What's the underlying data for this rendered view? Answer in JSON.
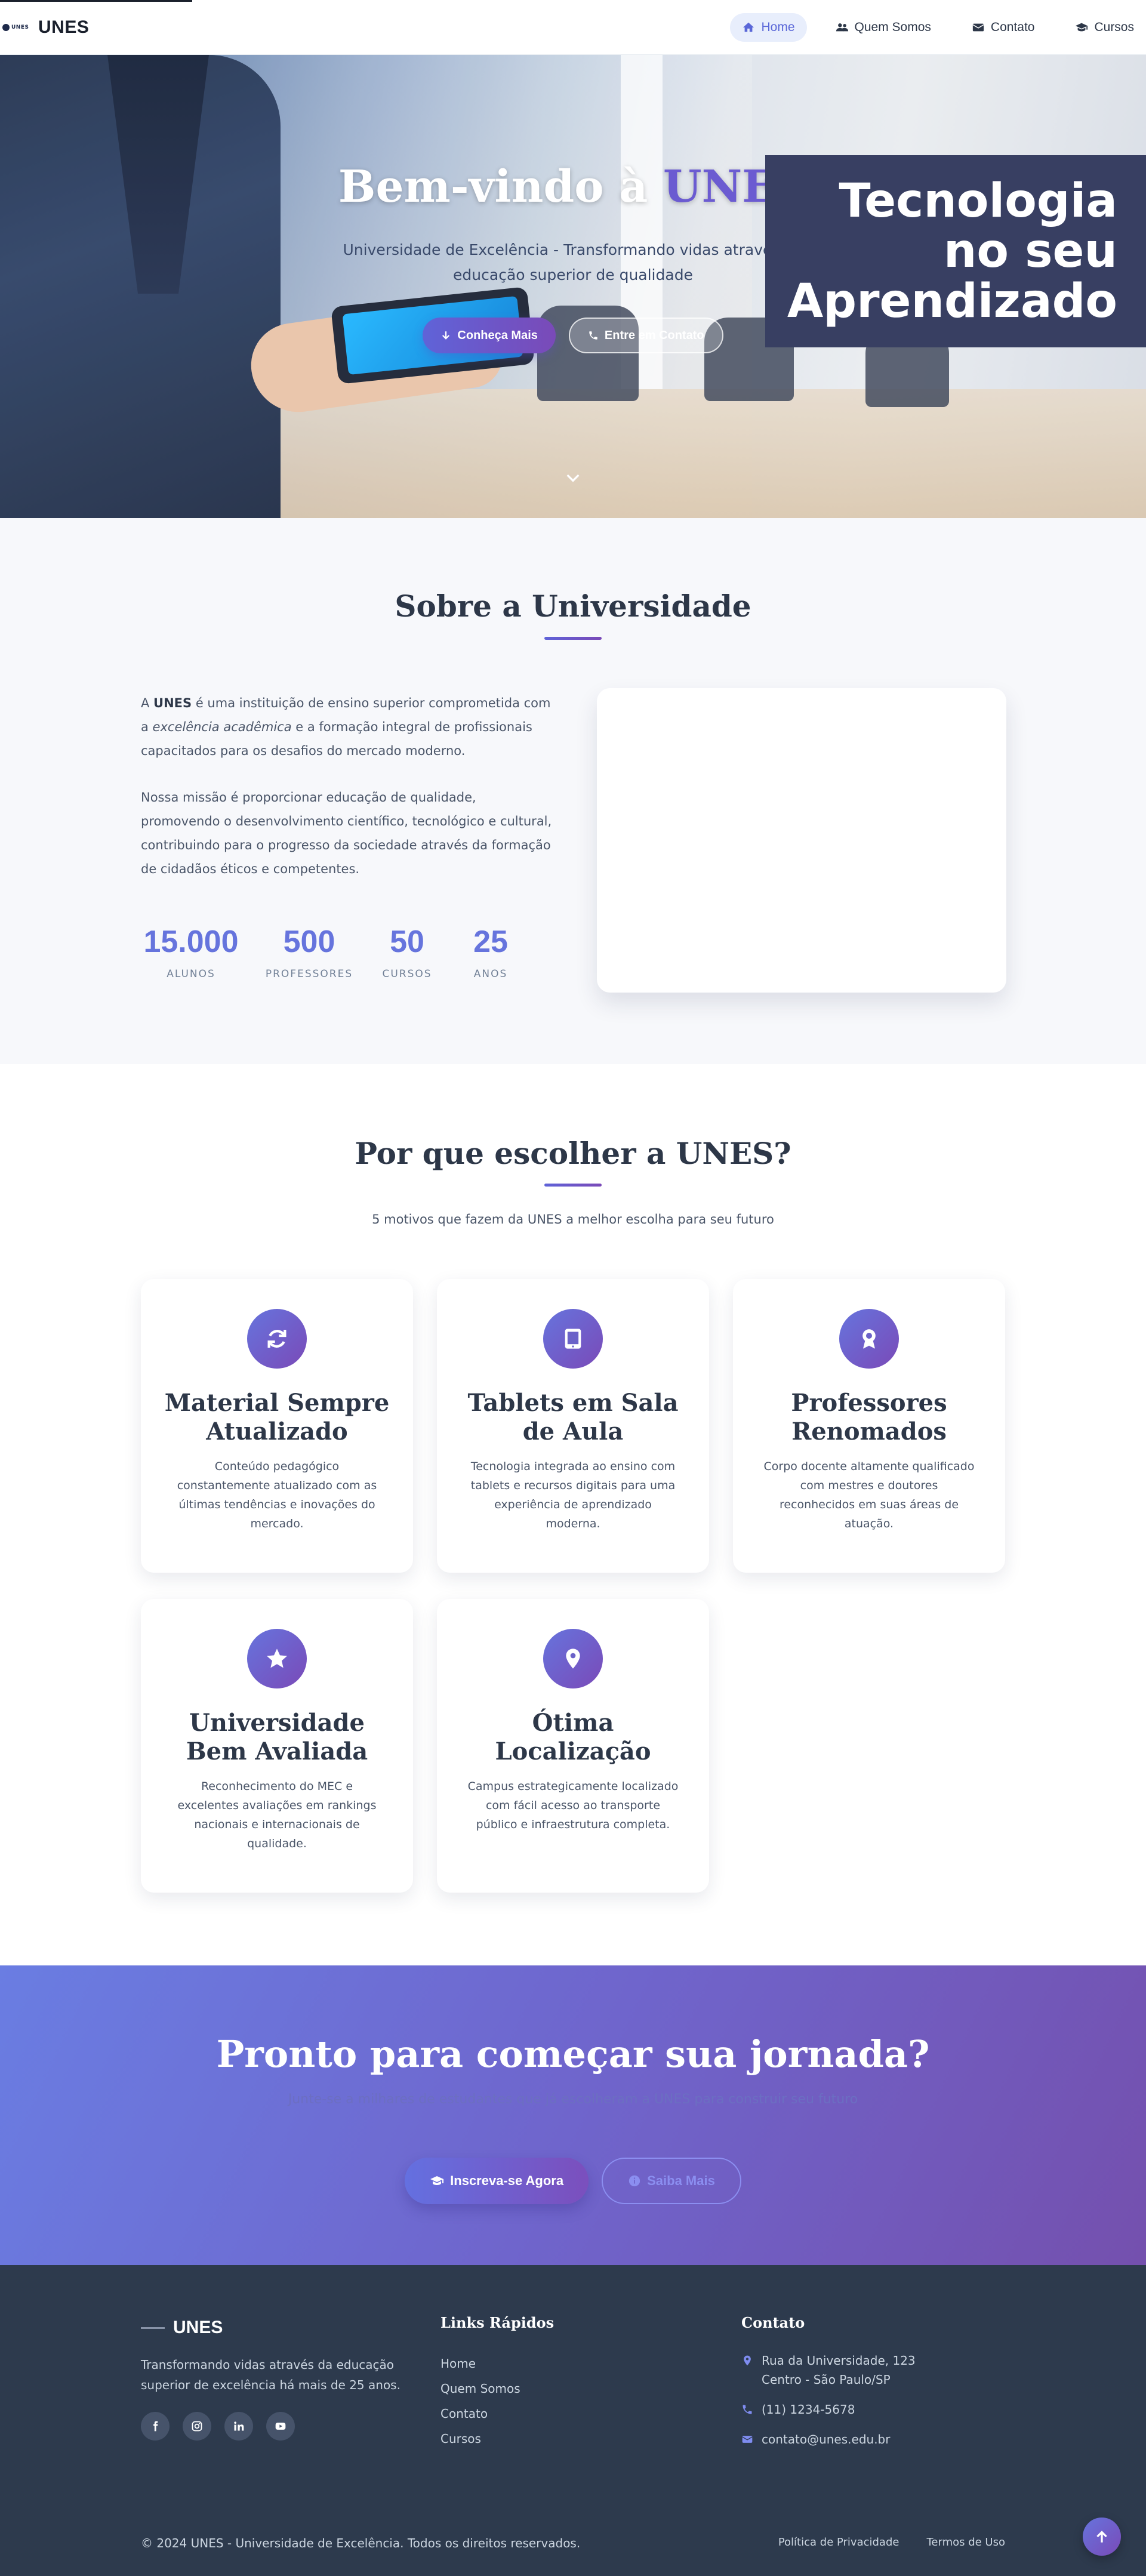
{
  "colors": {
    "primary": "#667eea",
    "secondary": "#764ba2",
    "dark": "#2d3748",
    "footer": "#2d3a4d"
  },
  "nav": {
    "brand_logo_text": "UNES",
    "brand": "UNES",
    "links": [
      {
        "label": "Home",
        "icon": "home-icon",
        "active": true
      },
      {
        "label": "Quem Somos",
        "icon": "users-icon",
        "active": false
      },
      {
        "label": "Contato",
        "icon": "envelope-icon",
        "active": false
      },
      {
        "label": "Cursos",
        "icon": "graduation-cap-icon",
        "active": false
      }
    ]
  },
  "hero": {
    "title_prefix": "Bem-vindo à ",
    "title_accent": "UNES",
    "subtitle": "Universidade de Excelência - Transformando vidas através da educação superior de qualidade",
    "btn_primary": "Conheça Mais",
    "btn_secondary": "Entre em Contato",
    "ad_lines": [
      "Tecnologia",
      "no seu",
      "Aprendizado"
    ]
  },
  "about": {
    "title": "Sobre a Universidade",
    "p1_prefix": "A ",
    "p1_bold": "UNES",
    "p1_mid": " é uma instituição de ensino superior comprometida com a ",
    "p1_italic": "excelência acadêmica",
    "p1_suffix": " e a formação integral de profissionais capacitados para os desafios do mercado moderno.",
    "p2": "Nossa missão é proporcionar educação de qualidade, promovendo o desenvolvimento científico, tecnológico e cultural, contribuindo para o progresso da sociedade através da formação de cidadãos éticos e competentes.",
    "stats": [
      {
        "value": "15.000",
        "label": "ALUNOS"
      },
      {
        "value": "500",
        "label": "PROFESSORES"
      },
      {
        "value": "50",
        "label": "CURSOS"
      },
      {
        "value": "25",
        "label": "ANOS"
      }
    ]
  },
  "why": {
    "title": "Por que escolher a UNES?",
    "subtitle": "5 motivos que fazem da UNES a melhor escolha para seu futuro",
    "cards": [
      {
        "icon": "sync-icon",
        "title": "Material Sempre Atualizado",
        "desc": "Conteúdo pedagógico constantemente atualizado com as últimas tendências e inovações do mercado."
      },
      {
        "icon": "tablet-icon",
        "title": "Tablets em Sala de Aula",
        "desc": "Tecnologia integrada ao ensino com tablets e recursos digitais para uma experiência de aprendizado moderna."
      },
      {
        "icon": "award-icon",
        "title": "Professores Renomados",
        "desc": "Corpo docente altamente qualificado com mestres e doutores reconhecidos em suas áreas de atuação."
      },
      {
        "icon": "star-icon",
        "title": "Universidade Bem Avaliada",
        "desc": "Reconhecimento do MEC e excelentes avaliações em rankings nacionais e internacionais de qualidade."
      },
      {
        "icon": "map-pin-icon",
        "title": "Ótima Localização",
        "desc": "Campus estrategicamente localizado com fácil acesso ao transporte público e infraestrutura completa."
      }
    ]
  },
  "cta": {
    "title": "Pronto para começar sua jornada?",
    "subtitle": "Junte-se a milhares de estudantes que já escolheram a UNES para construir seu futuro",
    "btn_primary": "Inscreva-se Agora",
    "btn_secondary": "Saiba Mais"
  },
  "footer": {
    "brand": "UNES",
    "desc": "Transformando vidas através da educação superior de excelência há mais de 25 anos.",
    "socials": [
      "facebook-icon",
      "instagram-icon",
      "linkedin-icon",
      "youtube-icon"
    ],
    "links_title": "Links Rápidos",
    "links": [
      "Home",
      "Quem Somos",
      "Contato",
      "Cursos"
    ],
    "contact_title": "Contato",
    "address_line1": "Rua da Universidade, 123",
    "address_line2": "Centro - São Paulo/SP",
    "phone": "(11) 1234-5678",
    "email": "contato@unes.edu.br",
    "copyright": "© 2024 UNES - Universidade de Excelência. Todos os direitos reservados.",
    "legal": [
      "Política de Privacidade",
      "Termos de Uso"
    ]
  }
}
